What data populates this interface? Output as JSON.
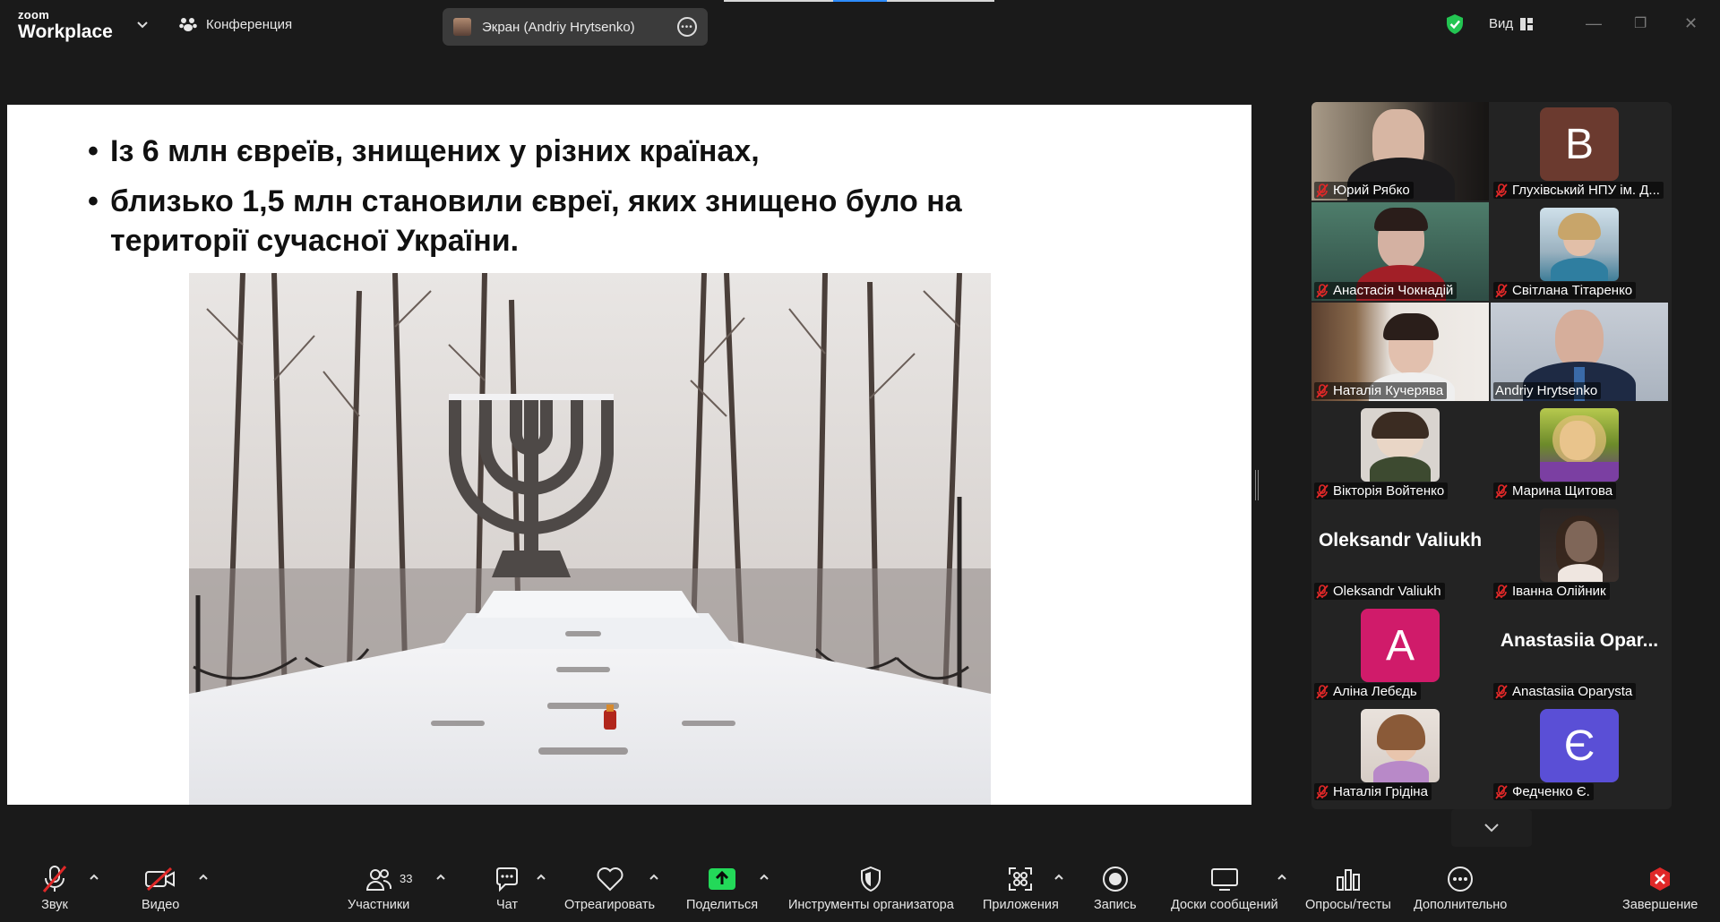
{
  "app": {
    "logo_small": "zoom",
    "logo_big": "Workplace"
  },
  "titlebar": {
    "conference_label": "Конференция",
    "screen_share_label": "Экран (Andriy Hrytsenko)",
    "view_label": "Вид"
  },
  "slide": {
    "bullets": [
      "Із 6 млн євреїв, знищених у різних країнах,",
      "близько 1,5 млн становили євреї, яких знищено було на території сучасної України."
    ]
  },
  "participants": [
    {
      "name": "Юрий Рябко",
      "kind": "video",
      "muted": true
    },
    {
      "name": "Глухівський НПУ ім. Д...",
      "kind": "letter",
      "letter": "В",
      "color": "#6b3a2f",
      "muted": true
    },
    {
      "name": "Анастасія Чокнадій",
      "kind": "video",
      "muted": true
    },
    {
      "name": "Світлана Тітаренко",
      "kind": "photo",
      "muted": true
    },
    {
      "name": "Наталія Кучерява",
      "kind": "video",
      "muted": true
    },
    {
      "name": "Andriy Hrytsenko",
      "kind": "video",
      "muted": false,
      "active": true
    },
    {
      "name": "Вікторія Войтенко",
      "kind": "photo",
      "muted": true
    },
    {
      "name": "Марина Щитова",
      "kind": "photo",
      "muted": true
    },
    {
      "name": "Oleksandr Valiukh",
      "kind": "text",
      "display": "Oleksandr Valiukh",
      "muted": true
    },
    {
      "name": "Іванна Олійник",
      "kind": "photo",
      "muted": true
    },
    {
      "name": "Аліна Лебєдь",
      "kind": "letter",
      "letter": "A",
      "color": "#d01b6a",
      "muted": true
    },
    {
      "name": "Anastasiia Oparysta",
      "kind": "text",
      "display": "Anastasiia  Opar...",
      "muted": true
    },
    {
      "name": "Наталія Грідіна",
      "kind": "photo",
      "muted": true
    },
    {
      "name": "Федченко Є.",
      "kind": "letter",
      "letter": "Є",
      "color": "#5a4fd6",
      "muted": true
    }
  ],
  "toolbar": {
    "audio": "Звук",
    "video": "Видео",
    "participants": "Участники",
    "participants_count": "33",
    "chat": "Чат",
    "react": "Отреагировать",
    "share": "Поделиться",
    "host_tools": "Инструменты организатора",
    "apps": "Приложения",
    "record": "Запись",
    "whiteboards": "Доски сообщений",
    "polls": "Опросы/тесты",
    "more": "Дополнительно",
    "end": "Завершение"
  },
  "colors": {
    "accent_green": "#23d959",
    "share_green": "#23d959",
    "end_red": "#e02828",
    "muted_red": "#e02828"
  }
}
